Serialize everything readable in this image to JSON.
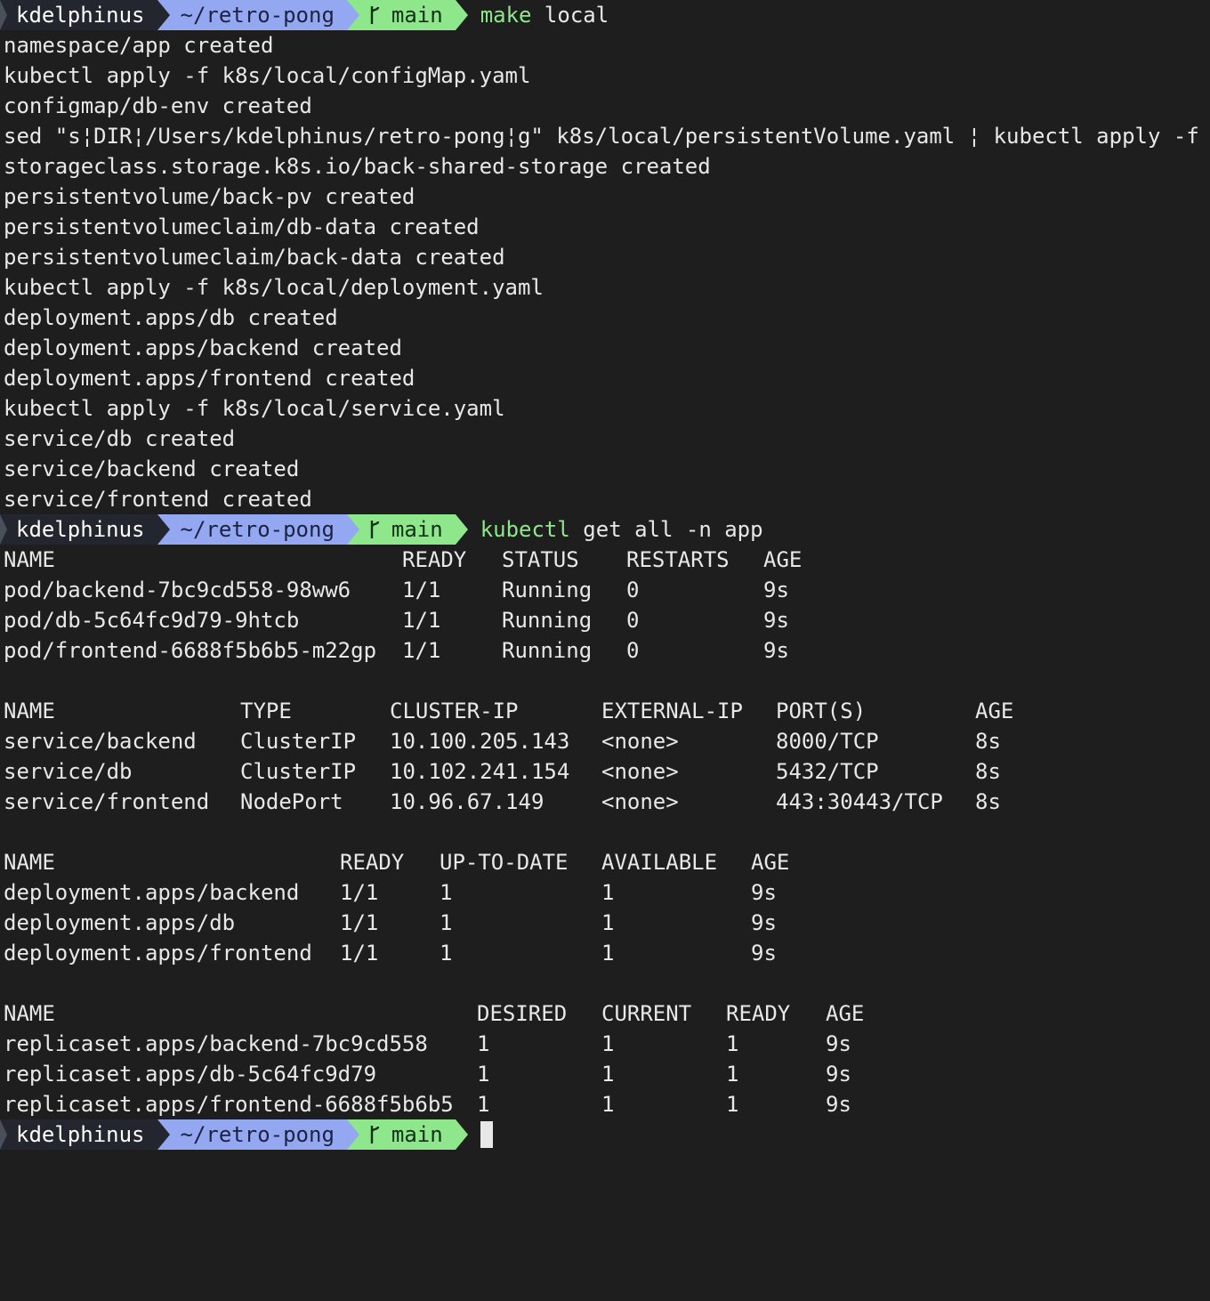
{
  "prompt": {
    "user": "kdelphinus",
    "path": "~/retro-pong",
    "branch": "main"
  },
  "commands": [
    {
      "exe": "make",
      "args": " local",
      "output": [
        "namespace/app created",
        "kubectl apply -f k8s/local/configMap.yaml",
        "configmap/db-env created",
        "sed \"s¦DIR¦/Users/kdelphinus/retro-pong¦g\" k8s/local/persistentVolume.yaml ¦ kubectl apply -f -",
        "storageclass.storage.k8s.io/back-shared-storage created",
        "persistentvolume/back-pv created",
        "persistentvolumeclaim/db-data created",
        "persistentvolumeclaim/back-data created",
        "kubectl apply -f k8s/local/deployment.yaml",
        "deployment.apps/db created",
        "deployment.apps/backend created",
        "deployment.apps/frontend created",
        "kubectl apply -f k8s/local/service.yaml",
        "service/db created",
        "service/backend created",
        "service/frontend created"
      ]
    },
    {
      "exe": "kubectl",
      "args": " get all -n app"
    }
  ],
  "tables": {
    "pods": {
      "headers": [
        "NAME",
        "READY",
        "STATUS",
        "RESTARTS",
        "AGE"
      ],
      "rows": [
        [
          "pod/backend-7bc9cd558-98ww6",
          "1/1",
          "Running",
          "0",
          "9s"
        ],
        [
          "pod/db-5c64fc9d79-9htcb",
          "1/1",
          "Running",
          "0",
          "9s"
        ],
        [
          "pod/frontend-6688f5b6b5-m22gp",
          "1/1",
          "Running",
          "0",
          "9s"
        ]
      ]
    },
    "services": {
      "headers": [
        "NAME",
        "TYPE",
        "CLUSTER-IP",
        "EXTERNAL-IP",
        "PORT(S)",
        "AGE"
      ],
      "rows": [
        [
          "service/backend",
          "ClusterIP",
          "10.100.205.143",
          "<none>",
          "8000/TCP",
          "8s"
        ],
        [
          "service/db",
          "ClusterIP",
          "10.102.241.154",
          "<none>",
          "5432/TCP",
          "8s"
        ],
        [
          "service/frontend",
          "NodePort",
          "10.96.67.149",
          "<none>",
          "443:30443/TCP",
          "8s"
        ]
      ]
    },
    "deployments": {
      "headers": [
        "NAME",
        "READY",
        "UP-TO-DATE",
        "AVAILABLE",
        "AGE"
      ],
      "rows": [
        [
          "deployment.apps/backend",
          "1/1",
          "1",
          "1",
          "9s"
        ],
        [
          "deployment.apps/db",
          "1/1",
          "1",
          "1",
          "9s"
        ],
        [
          "deployment.apps/frontend",
          "1/1",
          "1",
          "1",
          "9s"
        ]
      ]
    },
    "replicasets": {
      "headers": [
        "NAME",
        "DESIRED",
        "CURRENT",
        "READY",
        "AGE"
      ],
      "rows": [
        [
          "replicaset.apps/backend-7bc9cd558",
          "1",
          "1",
          "1",
          "9s"
        ],
        [
          "replicaset.apps/db-5c64fc9d79",
          "1",
          "1",
          "1",
          "9s"
        ],
        [
          "replicaset.apps/frontend-6688f5b6b5",
          "1",
          "1",
          "1",
          "9s"
        ]
      ]
    }
  },
  "colors": {
    "background": "#1e1e1e",
    "text": "#e8e8e8",
    "prompt_user_bg": "#23262e",
    "prompt_path_bg": "#93a8f0",
    "prompt_git_bg": "#8ee88b",
    "command_exe": "#8ee88b"
  },
  "icons": {
    "branch": "git-branch-icon",
    "separator": "powerline-arrow-icon"
  }
}
